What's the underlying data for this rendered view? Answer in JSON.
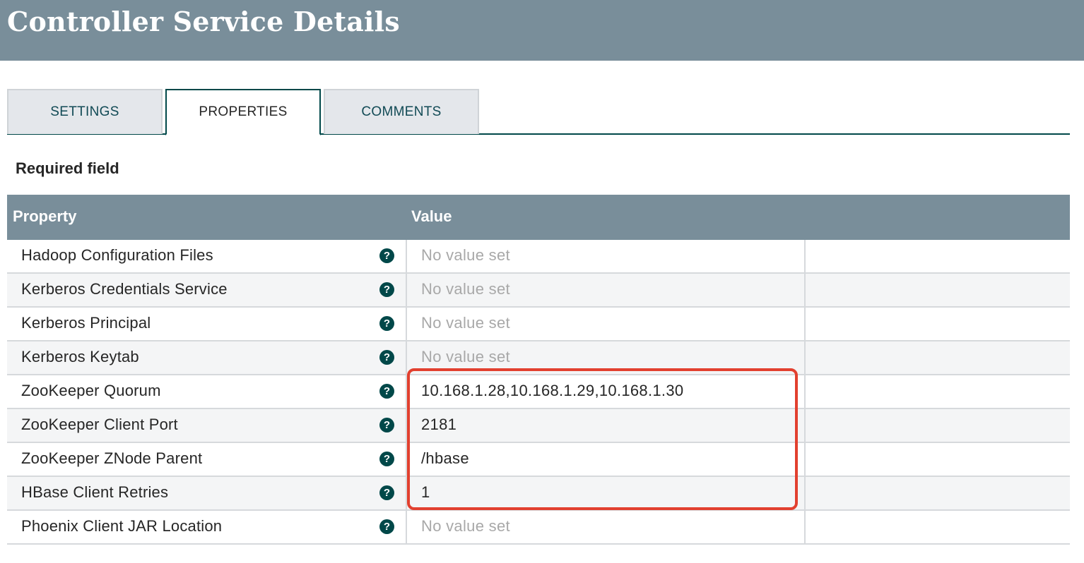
{
  "dialog": {
    "title": "Controller Service Details"
  },
  "tabs": [
    {
      "label": "SETTINGS",
      "active": false
    },
    {
      "label": "PROPERTIES",
      "active": true
    },
    {
      "label": "COMMENTS",
      "active": false
    }
  ],
  "required_label": "Required field",
  "table": {
    "columns": {
      "property": "Property",
      "value": "Value"
    },
    "rows": [
      {
        "name": "Hadoop Configuration Files",
        "value": "No value set",
        "is_set": false
      },
      {
        "name": "Kerberos Credentials Service",
        "value": "No value set",
        "is_set": false
      },
      {
        "name": "Kerberos Principal",
        "value": "No value set",
        "is_set": false
      },
      {
        "name": "Kerberos Keytab",
        "value": "No value set",
        "is_set": false
      },
      {
        "name": "ZooKeeper Quorum",
        "value": "10.168.1.28,10.168.1.29,10.168.1.30",
        "is_set": true
      },
      {
        "name": "ZooKeeper Client Port",
        "value": "2181",
        "is_set": true
      },
      {
        "name": "ZooKeeper ZNode Parent",
        "value": "/hbase",
        "is_set": true
      },
      {
        "name": "HBase Client Retries",
        "value": "1",
        "is_set": true
      },
      {
        "name": "Phoenix Client JAR Location",
        "value": "No value set",
        "is_set": false
      }
    ]
  },
  "help_icon_glyph": "?",
  "colors": {
    "header_bg": "#798e9a",
    "accent": "#004849",
    "highlight": "#e2402f",
    "placeholder_text": "#a8a8a8"
  }
}
